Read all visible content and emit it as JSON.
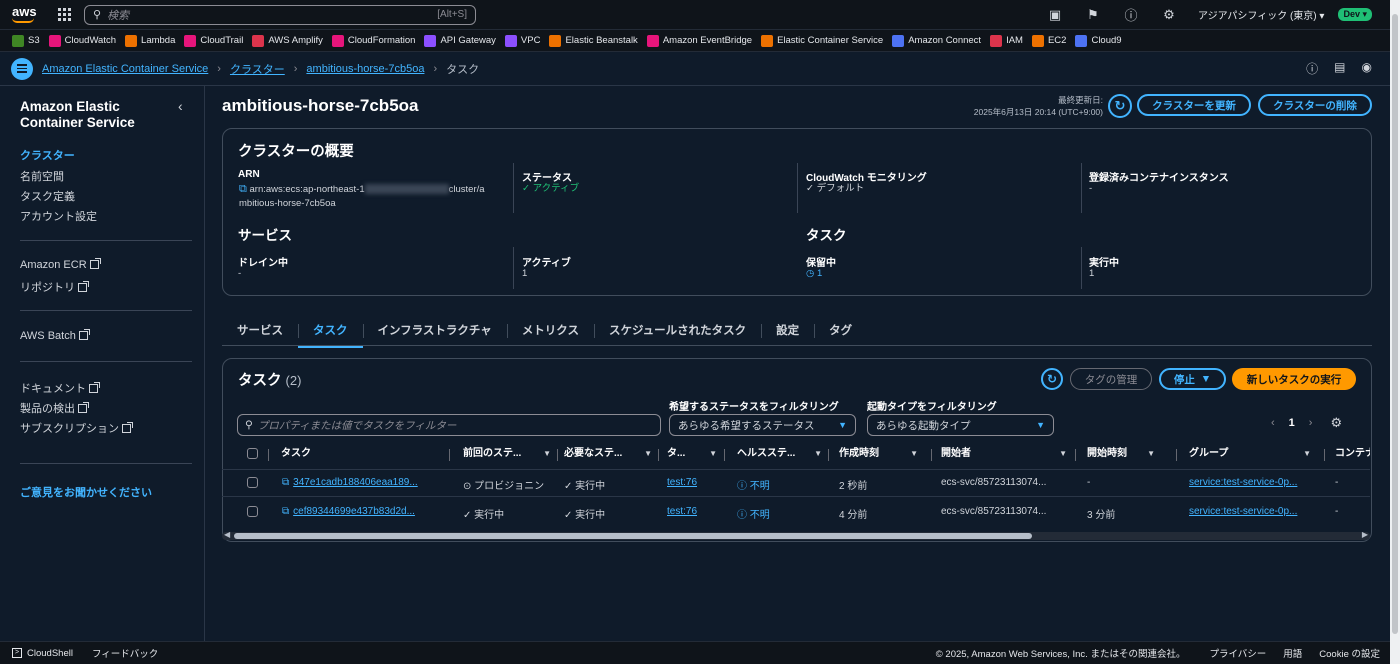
{
  "topnav": {
    "logo": "aws",
    "search_placeholder": "検索",
    "search_shortcut": "[Alt+S]",
    "region": "アジアパシフィック (東京)",
    "account_badge": "Dev"
  },
  "favorites": [
    {
      "label": "S3",
      "color": "#3f8624"
    },
    {
      "label": "CloudWatch",
      "color": "#e7157b"
    },
    {
      "label": "Lambda",
      "color": "#ed7100"
    },
    {
      "label": "CloudTrail",
      "color": "#e7157b"
    },
    {
      "label": "AWS Amplify",
      "color": "#dd344c"
    },
    {
      "label": "CloudFormation",
      "color": "#e7157b"
    },
    {
      "label": "API Gateway",
      "color": "#8c4fff"
    },
    {
      "label": "VPC",
      "color": "#8c4fff"
    },
    {
      "label": "Elastic Beanstalk",
      "color": "#ed7100"
    },
    {
      "label": "Amazon EventBridge",
      "color": "#e7157b"
    },
    {
      "label": "Elastic Container Service",
      "color": "#ed7100"
    },
    {
      "label": "Amazon Connect",
      "color": "#4d72f3"
    },
    {
      "label": "IAM",
      "color": "#dd344c"
    },
    {
      "label": "EC2",
      "color": "#ed7100"
    },
    {
      "label": "Cloud9",
      "color": "#4d72f3"
    }
  ],
  "breadcrumb": {
    "service": "Amazon Elastic Container Service",
    "cluster": "クラスター",
    "cluster_name": "ambitious-horse-7cb5oa",
    "current": "タスク"
  },
  "sidebar": {
    "title": "Amazon Elastic Container Service",
    "items": [
      "クラスター",
      "名前空間",
      "タスク定義",
      "アカウント設定"
    ],
    "ecr": [
      "Amazon ECR",
      "リポジトリ"
    ],
    "batch": "AWS Batch",
    "links": [
      "ドキュメント",
      "製品の検出",
      "サブスクリプション"
    ],
    "feedback": "ご意見をお聞かせください"
  },
  "header": {
    "title": "ambitious-horse-7cb5oa",
    "last_updated_label": "最終更新日:",
    "last_updated_value": "2025年6月13日 20:14 (UTC+9:00)",
    "update_button": "クラスターを更新",
    "delete_button": "クラスターの削除"
  },
  "overview": {
    "title": "クラスターの概要",
    "arn_label": "ARN",
    "arn_value_1": "arn:aws:ecs:ap-northeast-1",
    "arn_value_2": "cluster/a",
    "arn_value_3": "mbitious-horse-7cb5oa",
    "status_label": "ステータス",
    "status_value": "アクティブ",
    "cw_label": "CloudWatch モニタリング",
    "cw_value": "デフォルト",
    "reg_label": "登録済みコンテナインスタンス",
    "reg_value": "-",
    "services_title": "サービス",
    "drain_label": "ドレイン中",
    "drain_value": "-",
    "active_label": "アクティブ",
    "active_value": "1",
    "tasks_title": "タスク",
    "pending_label": "保留中",
    "pending_value": "1",
    "running_label": "実行中",
    "running_value": "1"
  },
  "tabs": [
    "サービス",
    "タスク",
    "インフラストラクチャ",
    "メトリクス",
    "スケジュールされたタスク",
    "設定",
    "タグ"
  ],
  "tasks": {
    "title": "タスク",
    "count": "(2)",
    "manage_tags": "タグの管理",
    "stop": "停止",
    "run_new": "新しいタスクの実行",
    "filter_placeholder": "プロパティまたは値でタスクをフィルター",
    "desired_status_label": "希望するステータスをフィルタリング",
    "desired_status_value": "あらゆる希望するステータス",
    "launch_type_label": "起動タイプをフィルタリング",
    "launch_type_value": "あらゆる起動タイプ",
    "page": "1",
    "columns": [
      "タスク",
      "前回のステ...",
      "必要なステ...",
      "タ...",
      "ヘルスステ...",
      "作成時刻",
      "開始者",
      "開始時刻",
      "グループ",
      "コンテナ"
    ],
    "rows": [
      {
        "task": "347e1cadb188406eaa189...",
        "last_status": "プロビジョニン",
        "desired": "実行中",
        "def": "test:76",
        "health": "不明",
        "created": "2 秒前",
        "started_by": "ecs-svc/85723113074...",
        "started_at": "-",
        "group": "service:test-service-0p...",
        "container": "-"
      },
      {
        "task": "cef89344699e437b83d2d...",
        "last_status": "実行中",
        "desired": "実行中",
        "def": "test:76",
        "health": "不明",
        "created": "4 分前",
        "started_by": "ecs-svc/85723113074...",
        "started_at": "3 分前",
        "group": "service:test-service-0p...",
        "container": "-"
      }
    ]
  },
  "footer": {
    "cloudshell": "CloudShell",
    "feedback": "フィードバック",
    "copyright": "© 2025, Amazon Web Services, Inc. またはその関連会社。",
    "privacy": "プライバシー",
    "terms": "用語",
    "cookie": "Cookie の設定"
  }
}
